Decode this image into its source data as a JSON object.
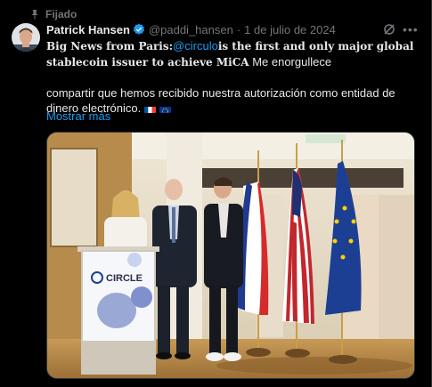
{
  "pinned": {
    "label": "Fijado"
  },
  "tweet": {
    "author_name": "Patrick Hansen",
    "handle": "@paddi_hansen",
    "separator": "·",
    "date": "1 de julio de 2024",
    "text_bold_1": "Big News from Paris:",
    "mention": "@circulo",
    "text_bold_2": "is the first and only major global",
    "text_bold_3": "stablecoin issuer to achieve MiCA",
    "text_plain_1": " Me enorgullece",
    "text_plain_2": "compartir que hemos recibido nuestra autorización como entidad de",
    "text_plain_3": "dinero electrónico.",
    "show_more": "Mostrar más"
  },
  "media": {
    "podium_brand": "CIRCLE"
  },
  "colors": {
    "accent": "#1d9bf0",
    "muted": "#71767b",
    "text": "#e7e9ea",
    "background": "#000000"
  },
  "icons": [
    "pin-icon",
    "verified-badge-icon",
    "grok-icon",
    "more-icon",
    "flag-france-icon",
    "flag-eu-icon"
  ]
}
